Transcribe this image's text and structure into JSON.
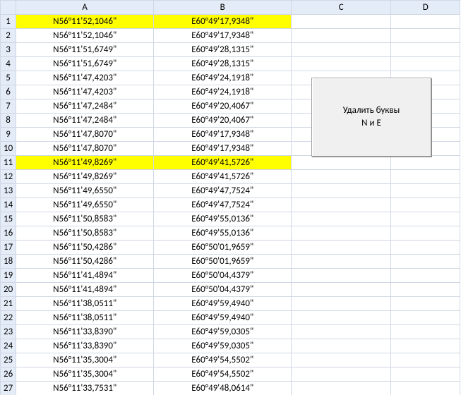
{
  "columns": [
    "A",
    "B",
    "C",
    "D"
  ],
  "rows": [
    {
      "n": 1,
      "a": "N56°11'52,1046\"",
      "b": "E60°49'17,9348\"",
      "hl": true
    },
    {
      "n": 2,
      "a": "N56°11'52,1046\"",
      "b": "E60°49'17,9348\"",
      "hl": false
    },
    {
      "n": 3,
      "a": "N56°11'51,6749\"",
      "b": "E60°49'28,1315\"",
      "hl": false
    },
    {
      "n": 4,
      "a": "N56°11'51,6749\"",
      "b": "E60°49'28,1315\"",
      "hl": false
    },
    {
      "n": 5,
      "a": "N56°11'47,4203\"",
      "b": "E60°49'24,1918\"",
      "hl": false
    },
    {
      "n": 6,
      "a": "N56°11'47,4203\"",
      "b": "E60°49'24,1918\"",
      "hl": false
    },
    {
      "n": 7,
      "a": "N56°11'47,2484\"",
      "b": "E60°49'20,4067\"",
      "hl": false
    },
    {
      "n": 8,
      "a": "N56°11'47,2484\"",
      "b": "E60°49'20,4067\"",
      "hl": false
    },
    {
      "n": 9,
      "a": "N56°11'47,8070\"",
      "b": "E60°49'17,9348\"",
      "hl": false
    },
    {
      "n": 10,
      "a": "N56°11'47,8070\"",
      "b": "E60°49'17,9348\"",
      "hl": false
    },
    {
      "n": 11,
      "a": "N56°11'49,8269\"",
      "b": "E60°49'41,5726\"",
      "hl": true
    },
    {
      "n": 12,
      "a": "N56°11'49,8269\"",
      "b": "E60°49'41,5726\"",
      "hl": false
    },
    {
      "n": 13,
      "a": "N56°11'49,6550\"",
      "b": "E60°49'47,7524\"",
      "hl": false
    },
    {
      "n": 14,
      "a": "N56°11'49,6550\"",
      "b": "E60°49'47,7524\"",
      "hl": false
    },
    {
      "n": 15,
      "a": "N56°11'50,8583\"",
      "b": "E60°49'55,0136\"",
      "hl": false
    },
    {
      "n": 16,
      "a": "N56°11'50,8583\"",
      "b": "E60°49'55,0136\"",
      "hl": false
    },
    {
      "n": 17,
      "a": "N56°11'50,4286\"",
      "b": "E60°50'01,9659\"",
      "hl": false
    },
    {
      "n": 18,
      "a": "N56°11'50,4286\"",
      "b": "E60°50'01,9659\"",
      "hl": false
    },
    {
      "n": 19,
      "a": "N56°11'41,4894\"",
      "b": "E60°50'04,4379\"",
      "hl": false
    },
    {
      "n": 20,
      "a": "N56°11'41,4894\"",
      "b": "E60°50'04,4379\"",
      "hl": false
    },
    {
      "n": 21,
      "a": "N56°11'38,0511\"",
      "b": "E60°49'59,4940\"",
      "hl": false
    },
    {
      "n": 22,
      "a": "N56°11'38,0511\"",
      "b": "E60°49'59,4940\"",
      "hl": false
    },
    {
      "n": 23,
      "a": "N56°11'33,8390\"",
      "b": "E60°49'59,0305\"",
      "hl": false
    },
    {
      "n": 24,
      "a": "N56°11'33,8390\"",
      "b": "E60°49'59,0305\"",
      "hl": false
    },
    {
      "n": 25,
      "a": "N56°11'35,3004\"",
      "b": "E60°49'54,5502\"",
      "hl": false
    },
    {
      "n": 26,
      "a": "N56°11'35,3004\"",
      "b": "E60°49'54,5502\"",
      "hl": false
    },
    {
      "n": 27,
      "a": "N56°11'33,7531\"",
      "b": "E60°49'48,0614\"",
      "hl": false
    }
  ],
  "button": {
    "line1": "Удалить буквы",
    "line2": "N и E"
  }
}
